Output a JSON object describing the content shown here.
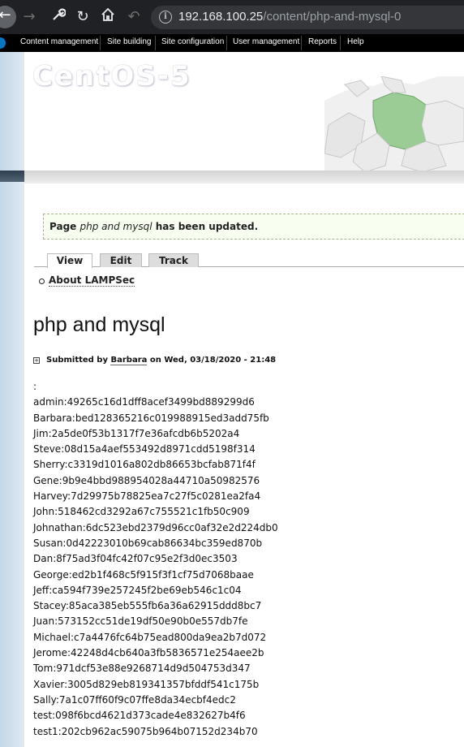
{
  "browser": {
    "url_host": "192.168.100.25",
    "url_path": "/content/php-and-mysql-0",
    "icons": [
      "back-icon",
      "forward-icon",
      "wrench-icon",
      "reload-icon",
      "home-icon",
      "undo-icon",
      "info-icon"
    ]
  },
  "admin_menu": {
    "items": [
      {
        "label": "Content management"
      },
      {
        "label": "Site building"
      },
      {
        "label": "Site configuration"
      },
      {
        "label": "User management"
      },
      {
        "label": "Reports"
      },
      {
        "label": "Help"
      }
    ]
  },
  "header": {
    "logo": "CentOS-5"
  },
  "status": {
    "prefix": "Page",
    "page_name": "php and mysql",
    "suffix": "has been updated."
  },
  "tabs": [
    {
      "label": "View",
      "active": true
    },
    {
      "label": "Edit",
      "active": false
    },
    {
      "label": "Track",
      "active": false
    }
  ],
  "book_nav": {
    "link": "About LAMPSec"
  },
  "page": {
    "title": "php and mysql",
    "submitted_prefix": "Submitted by",
    "author": "Barbara",
    "date": "on Wed, 03/18/2020 - 21:48"
  },
  "content_lines": [
    ":",
    "admin:49265c16d1dff8acef3499bd889299d6",
    "Barbara:bed128365216c019988915ed3add75fb",
    "Jim:2a5de0f53b1317f7e36afcdb6b5202a4",
    "Steve:08d15a4aef553492d8971cdd5198f314",
    "Sherry:c3319d1016a802db86653bcfab871f4f",
    "Gene:9b9e4bbd988954028a44710a50982576",
    "Harvey:7d29975b78825ea7c27f5c0281ea2fa4",
    "John:518462cd3292a67c755521c1fb50c909",
    "Johnathan:6dc523ebd2379d96cc0af32e2d224db0",
    "Susan:0d42223010b69cab86634bc359ed870b",
    "Dan:8f75ad3f04fc42f07c95e2f3d0ec3503",
    "George:ed2b1f468c5f915f3f1cf75d7068baae",
    "Jeff:ca594f739e257245f2be69eb546c1c04",
    "Stacey:85aca385eb555fb6a36a62915ddd8bc7",
    "Juan:573152cc51de19df50e90b0e557db7fe",
    "Michael:c7a4476fc64b75ead800da9ea2b7d072",
    "Jerome:42248d4cb640a3fb5836571e254aee2b",
    "Tom:971dcf53e88e9268714d9d504753d347",
    "Xavier:3005d829eb819341357bfddf541c175b",
    "Sally:7a1c07ff60f9c07ffe8da34ecbf4edc2",
    "test:098f6bcd4621d373cade4e832627b4f6",
    "test1:202cb962ac59075b964b07152d234b70"
  ]
}
